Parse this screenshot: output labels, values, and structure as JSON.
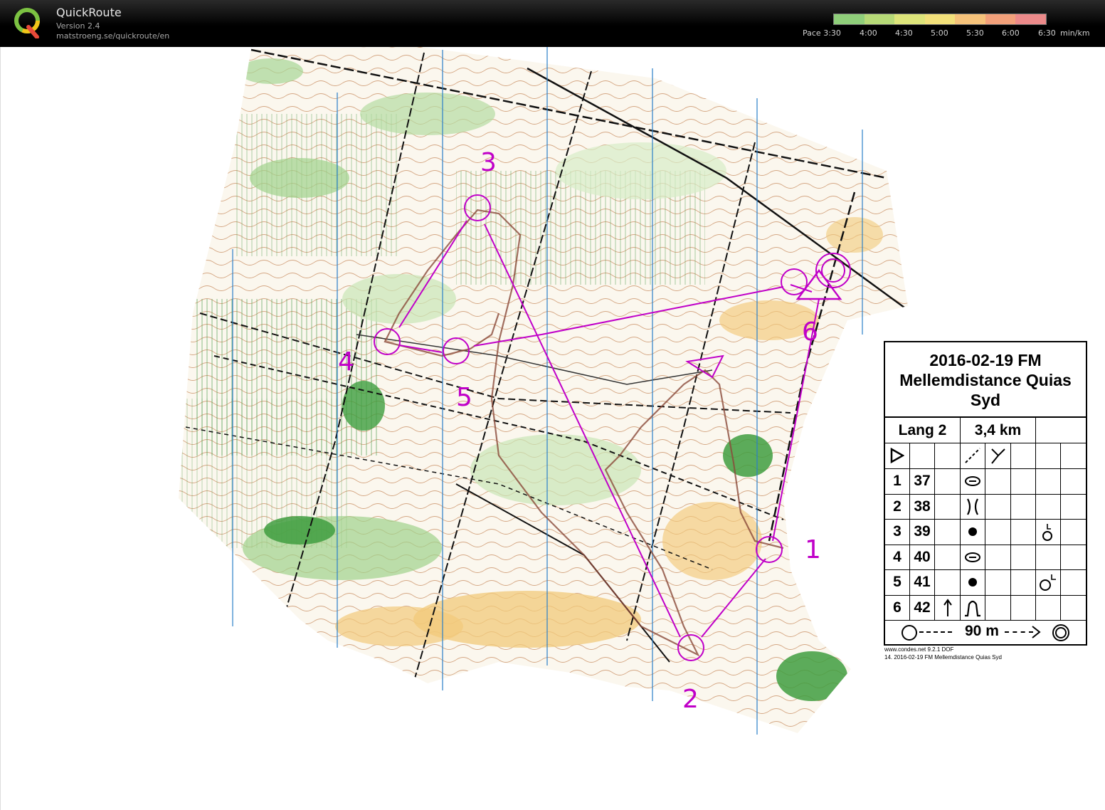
{
  "app": {
    "title": "QuickRoute",
    "version": "Version 2.4",
    "url": "matstroeng.se/quickroute/en"
  },
  "pace_scale": {
    "label_prefix": "Pace",
    "ticks": [
      "3:30",
      "4:00",
      "4:30",
      "5:00",
      "5:30",
      "6:00",
      "6:30"
    ],
    "unit": "min/km",
    "colors": [
      "#8fce7a",
      "#b6d977",
      "#dde47a",
      "#f2e07a",
      "#f5c27a",
      "#f2a07a",
      "#ec8a8a"
    ]
  },
  "course": {
    "title_line1": "2016-02-19 FM",
    "title_line2": "Mellemdistance Quias",
    "title_line3": "Syd",
    "class_name": "Lang 2",
    "length": "3,4 km",
    "controls": [
      {
        "num": "1",
        "code": "42",
        "symbol": "hill"
      },
      {
        "num": "1",
        "code": "37",
        "symbol": "knoll"
      },
      {
        "num": "2",
        "code": "38",
        "symbol": "reentrant"
      },
      {
        "num": "3",
        "code": "39",
        "symbol": "dot"
      },
      {
        "num": "4",
        "code": "40",
        "symbol": "knoll"
      },
      {
        "num": "5",
        "code": "41",
        "symbol": "dot"
      },
      {
        "num": "6",
        "code": "42",
        "symbol": "hill"
      }
    ],
    "finish_distance": "90 m",
    "footer1": "www.condes.net 9.2.1 DOF",
    "footer2": "14. 2016-02-19 FM Mellemdistance Quias Syd"
  },
  "map_labels": [
    "1",
    "2",
    "3",
    "4",
    "5",
    "6"
  ],
  "colors": {
    "course": "#c000c8",
    "contour": "#a0522d",
    "forest": "#4caf50",
    "open": "#f0c070",
    "north_line": "#2a7fc8"
  }
}
